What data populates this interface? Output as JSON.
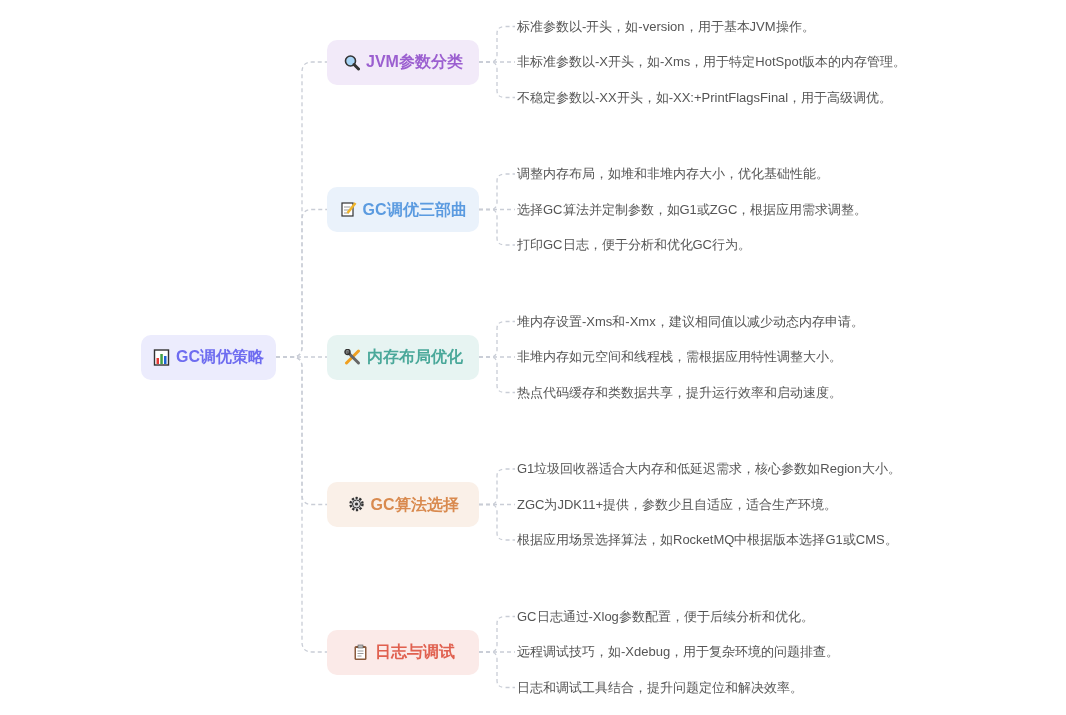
{
  "root": {
    "title": "GC调优策略",
    "color": "#6e6cf0"
  },
  "branches": [
    {
      "title": "JVM参数分类",
      "color": "#9b5fd0",
      "leaves": [
        "标准参数以-开头，如-version，用于基本JVM操作。",
        "非标准参数以-X开头，如-Xms，用于特定HotSpot版本的内存管理。",
        "不稳定参数以-XX开头，如-XX:+PrintFlagsFinal，用于高级调优。"
      ]
    },
    {
      "title": "GC调优三部曲",
      "color": "#5b9be0",
      "leaves": [
        "调整内存布局，如堆和非堆内存大小，优化基础性能。",
        "选择GC算法并定制参数，如G1或ZGC，根据应用需求调整。",
        "打印GC日志，便于分析和优化GC行为。"
      ]
    },
    {
      "title": "内存布局优化",
      "color": "#4aa89a",
      "leaves": [
        "堆内存设置-Xms和-Xmx，建议相同值以减少动态内存申请。",
        "非堆内存如元空间和线程栈，需根据应用特性调整大小。",
        "热点代码缓存和类数据共享，提升运行效率和启动速度。"
      ]
    },
    {
      "title": "GC算法选择",
      "color": "#d98a4f",
      "leaves": [
        "G1垃圾回收器适合大内存和低延迟需求，核心参数如Region大小。",
        "ZGC为JDK11+提供，参数少且自适应，适合生产环境。",
        "根据应用场景选择算法，如RocketMQ中根据版本选择G1或CMS。"
      ]
    },
    {
      "title": "日志与调试",
      "color": "#e0604f",
      "leaves": [
        "GC日志通过-Xlog参数配置，便于后续分析和优化。",
        "远程调试技巧，如-Xdebug，用于复杂环境的问题排查。",
        "日志和调试工具结合，提升问题定位和解决效率。"
      ]
    }
  ]
}
